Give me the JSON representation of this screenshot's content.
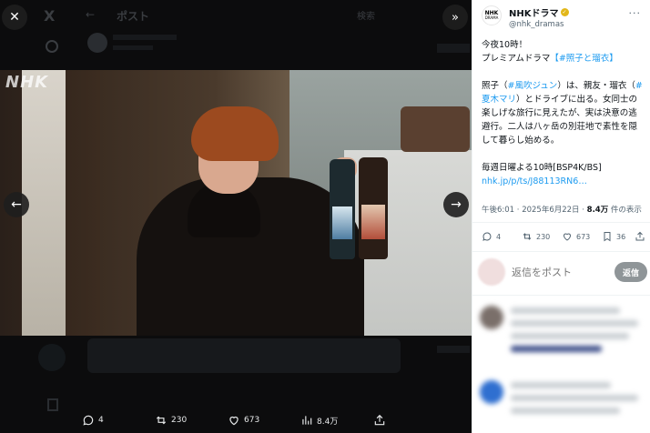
{
  "viewer": {
    "background_header": {
      "back_icon": "arrow-left-icon",
      "title": "ポスト",
      "search_label": "検索"
    },
    "actions": {
      "reply_count": "4",
      "repost_count": "230",
      "like_count": "673",
      "views_count": "8.4万"
    }
  },
  "media": {
    "watermark": "NHK"
  },
  "tweet": {
    "author": {
      "avatar_top": "NHK",
      "avatar_sub": "DRAMA",
      "display_name": "NHKドラマ",
      "handle": "@nhk_dramas"
    },
    "text": {
      "line1": "今夜10時！",
      "line2_prefix": "プレミアムドラマ",
      "line2_tag": "【#照子と瑠衣】",
      "para2_a": "照子（",
      "para2_tag1": "#風吹ジュン",
      "para2_b": "）は、親友・瑠衣（",
      "para2_tag2": "#夏木マリ",
      "para2_c": "）とドライブに出る。女同士の楽しげな旅行に見えたが、実は決意の逃避行。二人は八ヶ岳の別荘地で素性を隠して暮らし始める。",
      "para3": "毎週日曜よる10時[BSP4K/BS]",
      "link": "nhk.jp/p/ts/J88113RN6…"
    },
    "meta": {
      "time_date": "午後6:01 · 2025年6月22日 · ",
      "views": "8.4万",
      "views_suffix": " 件の表示"
    },
    "actions": {
      "reply_count": "4",
      "repost_count": "230",
      "like_count": "673",
      "bookmark_count": "36"
    },
    "reply_box": {
      "placeholder": "返信をポスト",
      "button_label": "返信"
    }
  },
  "colors": {
    "accent": "#1d9bf0",
    "verified": "#e2b719",
    "viewer_bg": "#000000"
  }
}
